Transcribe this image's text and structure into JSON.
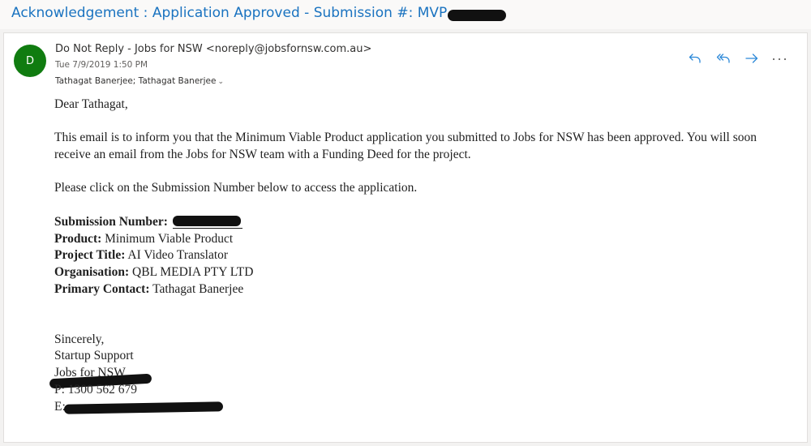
{
  "subject": {
    "text": "Acknowledgement : Application Approved - Submission #: MVP"
  },
  "sender": {
    "initial": "D",
    "name_line": "Do Not Reply - Jobs for NSW <noreply@jobsfornsw.com.au>",
    "date": "Tue 7/9/2019 1:50 PM",
    "recipients": "Tathagat Banerjee; Tathagat Banerjee"
  },
  "actions": {
    "icons": [
      "reply-icon",
      "reply-all-icon",
      "forward-icon",
      "more-actions-icon"
    ]
  },
  "body": {
    "greeting": "Dear Tathagat,",
    "para1": "This email is to inform you that the Minimum Viable Product application you submitted to Jobs for NSW has been approved. You will soon receive an email from the Jobs for NSW team with a Funding Deed for the project.",
    "para2": "Please click on the Submission Number below to access the application.",
    "fields": [
      {
        "label": "Submission Number:",
        "value": ""
      },
      {
        "label": "Product:",
        "value": "Minimum Viable Product"
      },
      {
        "label": "Project Title:",
        "value": "AI Video Translator"
      },
      {
        "label": "Organisation:",
        "value": "QBL MEDIA PTY LTD"
      },
      {
        "label": "Primary Contact:",
        "value": "Tathagat Banerjee"
      }
    ],
    "signature": {
      "closing": "Sincerely,",
      "team": "Startup Support",
      "org": "Jobs for NSW",
      "phone": "P: 1300 562 679",
      "email": "E:"
    }
  },
  "colors": {
    "accent": "#1a73c0",
    "avatar_bg": "#107c10",
    "action_icons": "#2b88d8"
  }
}
